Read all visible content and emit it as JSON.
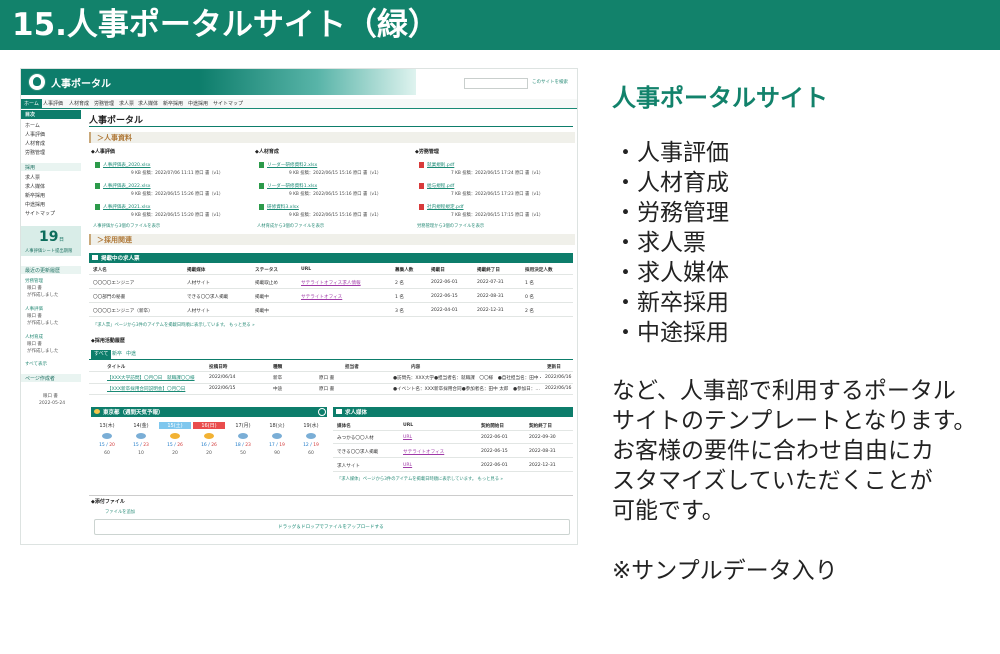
{
  "banner": {
    "title": "15.人事ポータルサイト（緑）"
  },
  "colors": {
    "brand_green": "#12826b",
    "accent_tan": "#b07a3a",
    "link_green": "#1a8a75",
    "link_purple": "#a03aa8"
  },
  "screenshot": {
    "header": {
      "portal_title": "人事ポータル",
      "search_hint": "このサイトを検索"
    },
    "nav": [
      "ホーム",
      "人事評価",
      "人材育成",
      "労務管理",
      "求人票",
      "求人媒体",
      "新卒採用",
      "中途採用",
      "サイトマップ"
    ],
    "sidebar": {
      "toc_label": "目次",
      "links1": [
        "ホーム",
        "人事評価",
        "人材育成",
        "労務管理"
      ],
      "section": "採用",
      "links2": [
        "求人票",
        "求人媒体",
        "新卒採用",
        "中途採用",
        "サイトマップ"
      ],
      "date_number": "19",
      "date_unit": "日",
      "date_caption": "人事評価シート提出期限",
      "updates_label": "最近の更新履歴",
      "updates": [
        {
          "title": "労務管理",
          "by": "眼口 書",
          "note": "が作成しました"
        },
        {
          "title": "人事評価",
          "by": "眼口 書",
          "note": "が作成しました"
        },
        {
          "title": "人材育成",
          "by": "眼口 書",
          "note": "が作成しました"
        }
      ],
      "show_all": "すべて表示",
      "author_label": "ページ作成者",
      "author_name": "眼口 書",
      "author_date": "2022-05-24"
    },
    "main": {
      "title": "人事ポータル",
      "sec_docs": "＞人事資料",
      "col1": {
        "head": "◆人事評価",
        "files": [
          {
            "name": "人事評価表_2020.xlsx",
            "meta": "9 KB 投稿：2022/07/06 11:11 原口 書（v1）"
          },
          {
            "name": "人事評価表_2022.xlsx",
            "meta": "9 KB 投稿：2022/06/15 15:26 原口 書（v1）"
          },
          {
            "name": "人事評価表_2021.xlsx",
            "meta": "9 KB 投稿：2022/06/15 15:20 原口 書（v1）"
          }
        ],
        "more": "人事評価から3個のファイルを表示"
      },
      "col2": {
        "head": "◆人材育成",
        "files": [
          {
            "name": "リーダー研修資料2.xlsx",
            "meta": "9 KB 投稿：2022/06/15 15:16 原口 書（v1）"
          },
          {
            "name": "リーダー研修資料1.xlsx",
            "meta": "9 KB 投稿：2022/06/15 15:16 原口 書（v1）"
          },
          {
            "name": "研修資料3.xlsx",
            "meta": "9 KB 投稿：2022/06/15 15:16 原口 書（v1）"
          }
        ],
        "more": "人材育成から3個のファイルを表示"
      },
      "col3": {
        "head": "◆労務管理",
        "files": [
          {
            "name": "就業規則.pdf",
            "meta": "7 KB 投稿：2022/06/15 17:24 原口 書（v1）"
          },
          {
            "name": "給与規程.pdf",
            "meta": "7 KB 投稿：2022/06/15 17:23 原口 書（v1）"
          },
          {
            "name": "社内規程規定.pdf",
            "meta": "7 KB 投稿：2022/06/15 17:15 原口 書（v1）"
          }
        ],
        "more": "労務管理から3個のファイルを表示"
      },
      "sec_hire": "＞採用関連",
      "jobs": {
        "title": "掲載中の求人票",
        "headers": [
          "求人名",
          "掲載媒体",
          "ステータス",
          "URL",
          "募集人数",
          "掲載日",
          "掲載終了日",
          "採用決定人数"
        ],
        "rows": [
          [
            "〇〇〇〇エンジニア",
            "人材サイト",
            "掲載取止め",
            "サテライトオフィス求人情報",
            "2 名",
            "2022-06-01",
            "2022-07-31",
            "1 名"
          ],
          [
            "〇〇部門の秘書",
            "できる〇〇求人掲載",
            "掲載中",
            "サテライトオフィス",
            "1 名",
            "2022-06-15",
            "2022-08-31",
            "0 名"
          ],
          [
            "〇〇〇〇エンジニア（新卒）",
            "人材サイト",
            "掲載中",
            "",
            "3 名",
            "2022-04-01",
            "2022-12-31",
            "2 名"
          ]
        ],
        "footer": "「求人票」ページから3件のアイテムを掲載日時順に表示しています。 もっと見る »"
      },
      "hist": {
        "title": "◆採用活動履歴",
        "tabs": [
          "すべて",
          "新卒",
          "中途"
        ],
        "headers": [
          "タイトル",
          "投稿日時",
          "種類",
          "担当者",
          "内容",
          "更新日"
        ],
        "rows": [
          [
            "【XXX大学訪問】〇月〇日　就職課〇〇様",
            "2022/06/14",
            "新卒",
            "原口 書",
            "●訪問先：XXX大学●担当者名：就職課　〇〇様　●自社担当名：田中・…",
            "2022/06/16"
          ],
          [
            "【XXX新卒採用合同説明会】〇月〇日",
            "2022/06/15",
            "中途",
            "原口 書",
            "●イベント名：XXX新卒採用合同●参加者名：田中 太郎　●参加日：…",
            "2022/06/16"
          ]
        ]
      },
      "weather": {
        "title": "東京都（週間天気予報）",
        "days": [
          {
            "day": "13(木)",
            "temp_hi": "20",
            "temp_lo": "15",
            "rain": "60"
          },
          {
            "day": "14(金)",
            "temp_hi": "23",
            "temp_lo": "15",
            "rain": "10"
          },
          {
            "day": "15(土)",
            "temp_hi": "26",
            "temp_lo": "15",
            "rain": "20"
          },
          {
            "day": "16(日)",
            "temp_hi": "26",
            "temp_lo": "16",
            "rain": "20"
          },
          {
            "day": "17(月)",
            "temp_hi": "23",
            "temp_lo": "18",
            "rain": "50"
          },
          {
            "day": "18(火)",
            "temp_hi": "19",
            "temp_lo": "17",
            "rain": "90"
          },
          {
            "day": "19(水)",
            "temp_hi": "19",
            "temp_lo": "12",
            "rain": "60"
          }
        ]
      },
      "media": {
        "title": "求人媒体",
        "headers": [
          "媒体名",
          "URL",
          "契約開始日",
          "契約終了日"
        ],
        "rows": [
          [
            "みつかる〇〇人材",
            "URL",
            "2022-06-01",
            "2022-09-30"
          ],
          [
            "できる〇〇求人掲載",
            "サテライトオフィス",
            "2022-06-15",
            "2022-08-31"
          ],
          [
            "求人サイト",
            "URL",
            "2022-06-01",
            "2022-12-31"
          ]
        ],
        "footer": "「求人媒体」ページから3件のアイテムを掲載日時順に表示しています。 もっと見る »"
      },
      "attach": {
        "title": "◆添付ファイル",
        "add": "ファイルを追加",
        "upload": "ドラッグ＆ドロップでファイルをアップロードする"
      }
    }
  },
  "side": {
    "heading": "人事ポータルサイト",
    "bullets": [
      "・人事評価",
      "・人材育成",
      "・労務管理",
      "・求人票",
      "・求人媒体",
      "・新卒採用",
      "・中途採用"
    ],
    "desc": [
      "など、人事部で利用するポータル",
      "サイトのテンプレートとなります。",
      "お客様の要件に合わせ自由にカ",
      "スタマイズしていただくことが",
      "可能です。"
    ],
    "note": "※サンプルデータ入り"
  }
}
